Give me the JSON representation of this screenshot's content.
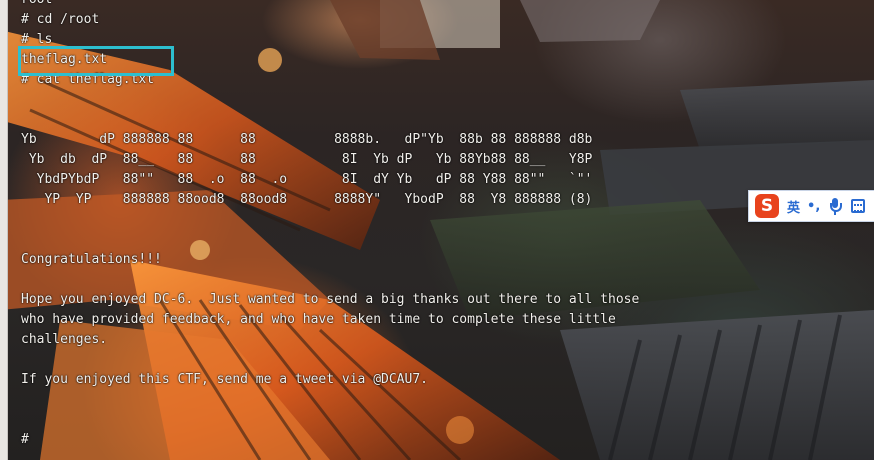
{
  "terminal": {
    "lines": [
      "root",
      "# cd /root",
      "# ls",
      "theflag.txt",
      "# cat theflag.txt",
      "",
      "",
      "Yb        dP 888888 88      88          8888b.   dP\"Yb  88b 88 888888 d8b",
      " Yb  db  dP  88__   88      88           8I  Yb dP   Yb 88Yb88 88__   Y8P",
      "  YbdPYbdP   88\"\"   88  .o  88  .o       8I  dY Yb   dP 88 Y88 88\"\"   `\"'",
      "   YP  YP    888888 88ood8  88ood8      8888Y\"   YbodP  88  Y8 888888 (8)",
      "",
      "",
      "Congratulations!!!",
      "",
      "Hope you enjoyed DC-6.  Just wanted to send a big thanks out there to all those",
      "who have provided feedback, and who have taken time to complete these little",
      "challenges.",
      "",
      "If you enjoyed this CTF, send me a tweet via @DCAU7.",
      "",
      "",
      "#"
    ]
  },
  "ime": {
    "logo": "S",
    "language": "英",
    "punctuation": "•,",
    "mic_icon": "microphone-icon",
    "keyboard_icon": "keyboard-icon"
  },
  "colors": {
    "terminal_text": "#f2f0ec",
    "highlight_box": "#2dbfcf",
    "ime_accent": "#2a6bd1",
    "ime_logo": "#e8431d"
  }
}
